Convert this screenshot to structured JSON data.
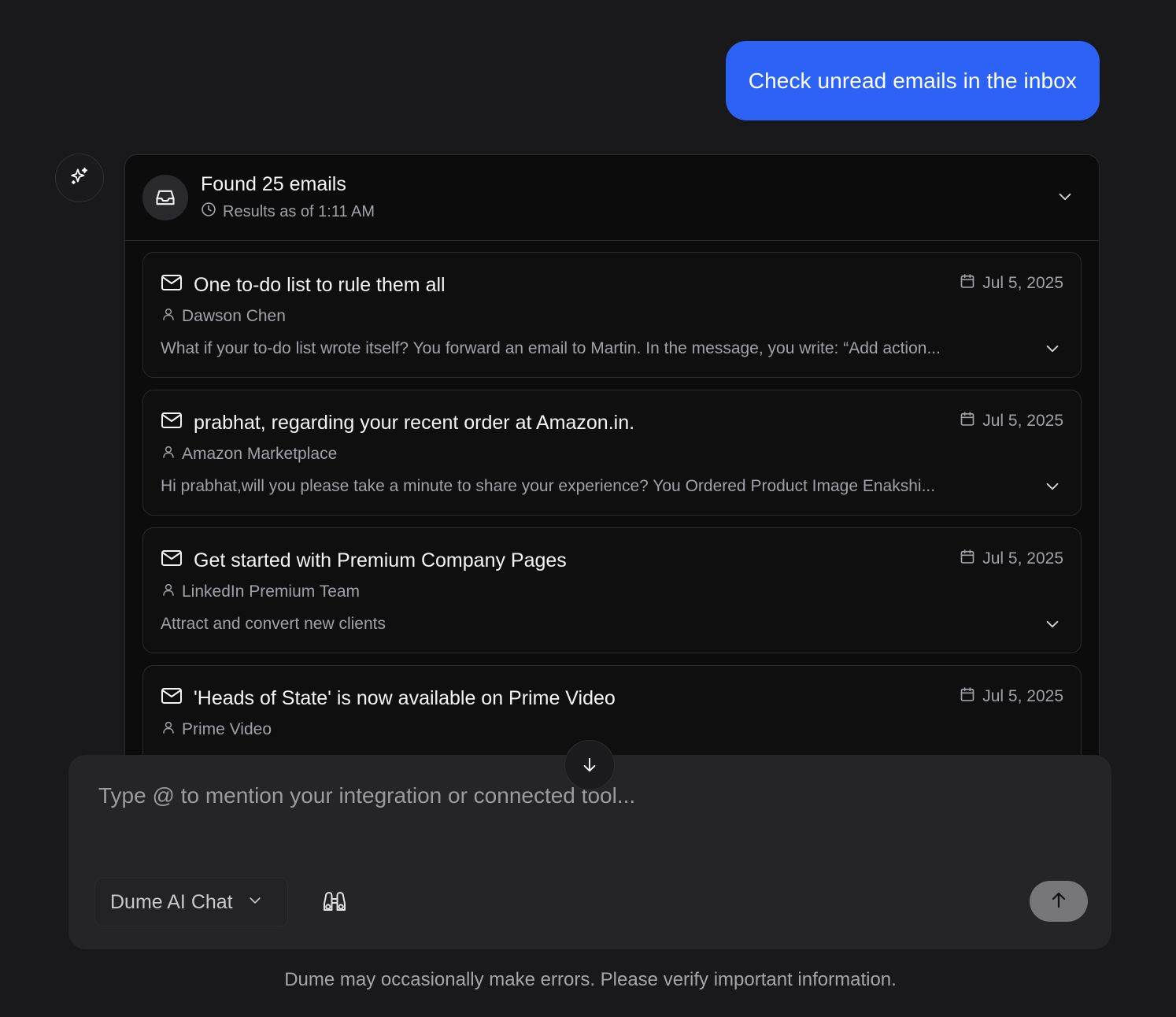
{
  "user_message": "Check unread emails in the inbox",
  "results": {
    "title": "Found 25 emails",
    "subtitle": "Results as of 1:11 AM",
    "emails": [
      {
        "subject": "One to-do list to rule them all",
        "date": "Jul 5, 2025",
        "sender": "Dawson Chen",
        "preview": "What if your to-do list wrote itself? You forward an email to Martin. In the message, you write: “Add action..."
      },
      {
        "subject": "prabhat, regarding your recent order at Amazon.in.",
        "date": "Jul 5, 2025",
        "sender": "Amazon Marketplace",
        "preview": "Hi prabhat,will you please take a minute to share your experience? You Ordered Product Image Enakshi..."
      },
      {
        "subject": "Get started with Premium Company Pages",
        "date": "Jul 5, 2025",
        "sender": "LinkedIn Premium Team",
        "preview": "Attract and convert new clients"
      },
      {
        "subject": "'Heads of State' is now available on Prime Video",
        "date": "Jul 5, 2025",
        "sender": "Prime Video",
        "preview": ""
      }
    ]
  },
  "composer": {
    "placeholder": "Type @ to mention your integration or connected tool...",
    "model_label": "Dume AI Chat"
  },
  "disclaimer": "Dume may occasionally make errors. Please verify important information.",
  "icons": {
    "assistant": "sparkles-icon",
    "inbox": "inbox-icon",
    "clock": "clock-icon",
    "mail": "mail-icon",
    "calendar": "calendar-icon",
    "user": "user-icon",
    "expand": "chevron-down-icon",
    "scroll": "arrow-down-icon",
    "research": "binoculars-icon",
    "send": "arrow-up-icon"
  },
  "colors": {
    "background": "#19191b",
    "user_bubble": "#2c63f6",
    "card": "#0c0c0d",
    "composer": "#252527",
    "muted_text": "#a1a1a7"
  }
}
